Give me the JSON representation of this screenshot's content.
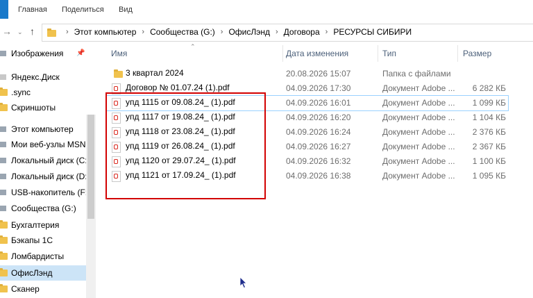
{
  "ribbon": {
    "tabs": [
      "Главная",
      "Поделиться",
      "Вид"
    ]
  },
  "address": {
    "crumbs": [
      "Этот компьютер",
      "Сообщества (G:)",
      "ОфисЛэнд",
      "Договора",
      "РЕСУРСЫ СИБИРИ"
    ],
    "separator": "›"
  },
  "nav": {
    "items": [
      {
        "label": "Изображения",
        "icon": "pictures-icon",
        "pinned": true
      },
      {
        "label": "Яндекс.Диск",
        "icon": "cloud-icon"
      },
      {
        "label": ".sync",
        "icon": "folder-icon"
      },
      {
        "label": "Скриншоты",
        "icon": "folder-icon"
      },
      {
        "label": "Этот компьютер",
        "icon": "computer-icon"
      },
      {
        "label": "Мои веб-узлы MSN",
        "icon": "web-folder-icon"
      },
      {
        "label": "Локальный диск (C:)",
        "icon": "drive-icon"
      },
      {
        "label": "Локальный диск (D:)",
        "icon": "drive-icon"
      },
      {
        "label": "USB-накопитель (F:)",
        "icon": "usb-drive-icon"
      },
      {
        "label": "Сообщества (G:)",
        "icon": "network-drive-icon"
      },
      {
        "label": "Бухгалтерия",
        "icon": "folder-icon"
      },
      {
        "label": "Бэкапы 1С",
        "icon": "folder-icon"
      },
      {
        "label": "Ломбардисты",
        "icon": "folder-icon"
      },
      {
        "label": "ОфисЛэнд",
        "icon": "folder-icon",
        "selected": true
      },
      {
        "label": "Сканер",
        "icon": "folder-icon"
      }
    ]
  },
  "columns": {
    "name": "Имя",
    "date": "Дата изменения",
    "type": "Тип",
    "size": "Размер"
  },
  "files": [
    {
      "name": "3 квартал 2024",
      "date": "20.08.2026 15:07",
      "type": "Папка с файлами",
      "size": "",
      "icon": "folder-icon"
    },
    {
      "name": "Договор № 01.07.24 (1).pdf",
      "date": "04.09.2026 17:30",
      "type": "Документ Adobe ...",
      "size": "6 282 КБ",
      "icon": "pdf-icon"
    },
    {
      "name": "упд 1115 от 09.08.24_ (1).pdf",
      "date": "04.09.2026 16:01",
      "type": "Документ Adobe ...",
      "size": "1 099 КБ",
      "icon": "pdf-icon",
      "focused": true
    },
    {
      "name": "упд 1117 от 19.08.24_ (1).pdf",
      "date": "04.09.2026 16:20",
      "type": "Документ Adobe ...",
      "size": "1 104 КБ",
      "icon": "pdf-icon"
    },
    {
      "name": "упд 1118 от 23.08.24_ (1).pdf",
      "date": "04.09.2026 16:24",
      "type": "Документ Adobe ...",
      "size": "2 376 КБ",
      "icon": "pdf-icon"
    },
    {
      "name": "упд 1119 от 26.08.24_ (1).pdf",
      "date": "04.09.2026 16:27",
      "type": "Документ Adobe ...",
      "size": "2 367 КБ",
      "icon": "pdf-icon"
    },
    {
      "name": "упд 1120 от 29.07.24_ (1).pdf",
      "date": "04.09.2026 16:32",
      "type": "Документ Adobe ...",
      "size": "1 100 КБ",
      "icon": "pdf-icon"
    },
    {
      "name": "упд 1121 от 17.09.24_ (1).pdf",
      "date": "04.09.2026 16:38",
      "type": "Документ Adobe ...",
      "size": "1 095 КБ",
      "icon": "pdf-icon"
    }
  ],
  "colors": {
    "accent": "#1979ca",
    "highlight": "#d20000",
    "selection": "#cce4f7"
  }
}
